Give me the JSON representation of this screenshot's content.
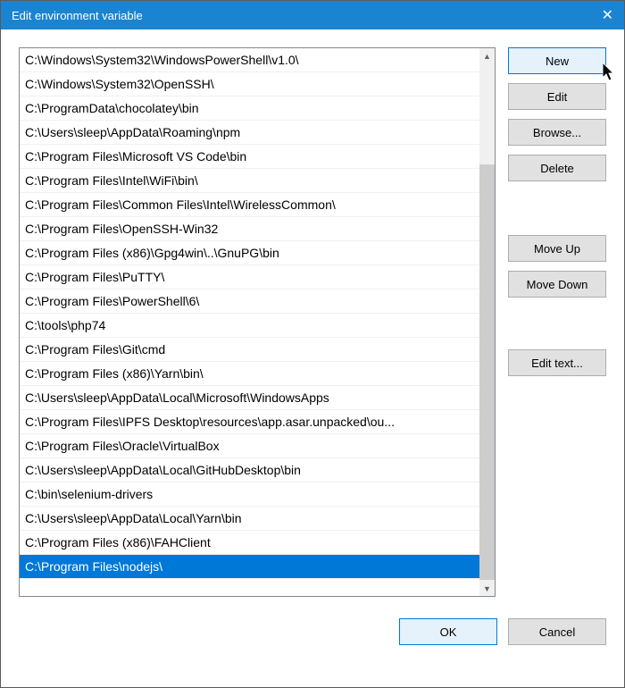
{
  "window": {
    "title": "Edit environment variable"
  },
  "list": {
    "items": [
      "C:\\Windows\\System32\\WindowsPowerShell\\v1.0\\",
      "C:\\Windows\\System32\\OpenSSH\\",
      "C:\\ProgramData\\chocolatey\\bin",
      "C:\\Users\\sleep\\AppData\\Roaming\\npm",
      "C:\\Program Files\\Microsoft VS Code\\bin",
      "C:\\Program Files\\Intel\\WiFi\\bin\\",
      "C:\\Program Files\\Common Files\\Intel\\WirelessCommon\\",
      "C:\\Program Files\\OpenSSH-Win32",
      "C:\\Program Files (x86)\\Gpg4win\\..\\GnuPG\\bin",
      "C:\\Program Files\\PuTTY\\",
      "C:\\Program Files\\PowerShell\\6\\",
      "C:\\tools\\php74",
      "C:\\Program Files\\Git\\cmd",
      "C:\\Program Files (x86)\\Yarn\\bin\\",
      "C:\\Users\\sleep\\AppData\\Local\\Microsoft\\WindowsApps",
      "C:\\Program Files\\IPFS Desktop\\resources\\app.asar.unpacked\\ou...",
      "C:\\Program Files\\Oracle\\VirtualBox",
      "C:\\Users\\sleep\\AppData\\Local\\GitHubDesktop\\bin",
      "C:\\bin\\selenium-drivers",
      "C:\\Users\\sleep\\AppData\\Local\\Yarn\\bin",
      "C:\\Program Files (x86)\\FAHClient",
      "C:\\Program Files\\nodejs\\"
    ],
    "selected_index": 21
  },
  "buttons": {
    "new_label": "New",
    "edit_label": "Edit",
    "browse_label": "Browse...",
    "delete_label": "Delete",
    "move_up_label": "Move Up",
    "move_down_label": "Move Down",
    "edit_text_label": "Edit text...",
    "ok_label": "OK",
    "cancel_label": "Cancel"
  }
}
